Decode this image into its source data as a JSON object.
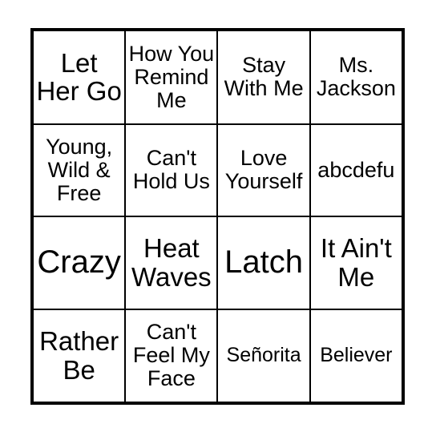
{
  "card": {
    "type": "bingo-card",
    "columns": 4,
    "rows": 4,
    "colors": {
      "border": "#000000",
      "cell_background": "#ffffff",
      "text": "#000000",
      "page_background": "#ffffff"
    },
    "cells": [
      {
        "text": "Let Her Go",
        "size": "lg",
        "row": 1,
        "col": 1
      },
      {
        "text": "How You Remind Me",
        "size": "md",
        "row": 1,
        "col": 2
      },
      {
        "text": "Stay With Me",
        "size": "md",
        "row": 1,
        "col": 3
      },
      {
        "text": "Ms. Jackson",
        "size": "md",
        "row": 1,
        "col": 4
      },
      {
        "text": "Young, Wild & Free",
        "size": "md",
        "row": 2,
        "col": 1
      },
      {
        "text": "Can't Hold Us",
        "size": "md",
        "row": 2,
        "col": 2
      },
      {
        "text": "Love Yourself",
        "size": "md",
        "row": 2,
        "col": 3
      },
      {
        "text": "abcdefu",
        "size": "md",
        "row": 2,
        "col": 4
      },
      {
        "text": "Crazy",
        "size": "xl",
        "row": 3,
        "col": 1
      },
      {
        "text": "Heat Waves",
        "size": "lg",
        "row": 3,
        "col": 2
      },
      {
        "text": "Latch",
        "size": "xl",
        "row": 3,
        "col": 3
      },
      {
        "text": "It Ain't Me",
        "size": "lg",
        "row": 3,
        "col": 4
      },
      {
        "text": "Rather Be",
        "size": "lg",
        "row": 4,
        "col": 1
      },
      {
        "text": "Can't Feel My Face",
        "size": "md",
        "row": 4,
        "col": 2
      },
      {
        "text": "Señorita",
        "size": "sm",
        "row": 4,
        "col": 3
      },
      {
        "text": "Believer",
        "size": "sm",
        "row": 4,
        "col": 4
      }
    ]
  }
}
